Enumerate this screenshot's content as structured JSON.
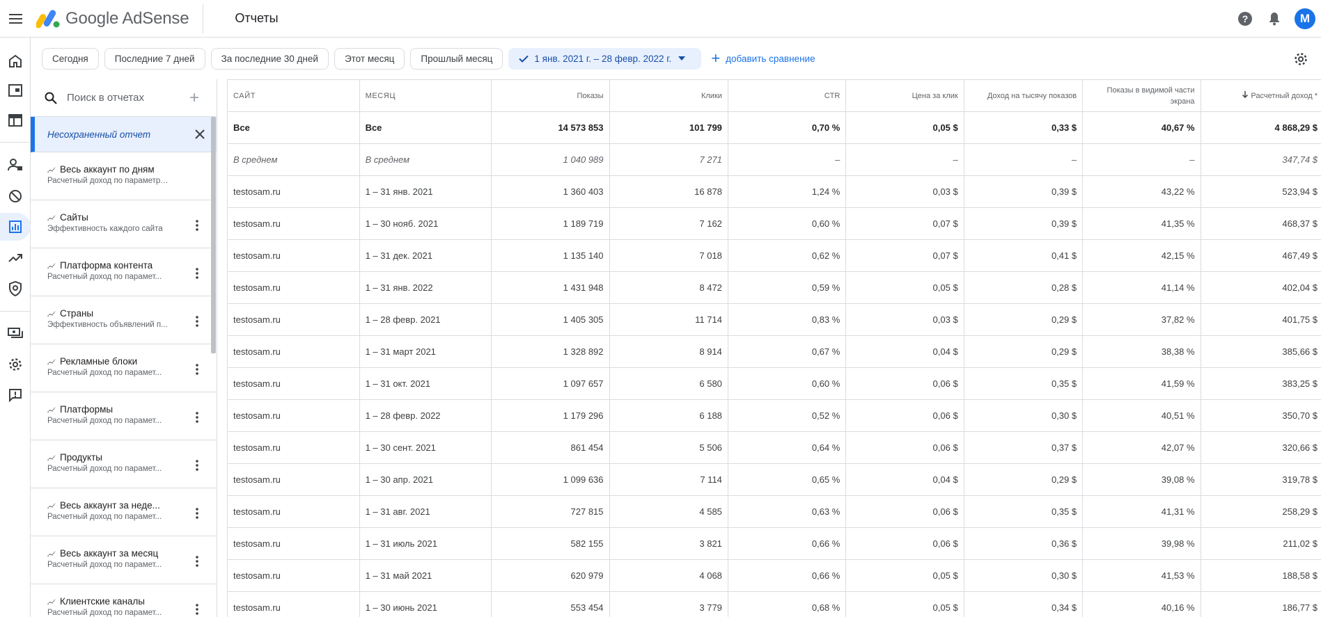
{
  "header": {
    "app_name": "Google AdSense",
    "page_title": "Отчеты",
    "avatar_letter": "M"
  },
  "colors": {
    "accent": "#1a73e8",
    "selected_bg": "#e8f0fe",
    "border": "#dadce0"
  },
  "filters": {
    "today": "Сегодня",
    "last7": "Последние 7 дней",
    "last30": "За последние 30 дней",
    "this_month": "Этот месяц",
    "last_month": "Прошлый месяц",
    "date_range": "1 янв. 2021 г. – 28 февр. 2022 г.",
    "add_compare": "добавить сравнение"
  },
  "reports": {
    "search_placeholder": "Поиск в отчетах",
    "unsaved": "Несохраненный отчет",
    "items": [
      {
        "title": "Весь аккаунт по дням",
        "sub": "Расчетный доход по параметру \"Дата\"",
        "menu": false
      },
      {
        "title": "Сайты",
        "sub": "Эффективность каждого сайта",
        "menu": true
      },
      {
        "title": "Платформа контента",
        "sub": "Расчетный доход по парамет...",
        "menu": true
      },
      {
        "title": "Страны",
        "sub": "Эффективность объявлений п...",
        "menu": true
      },
      {
        "title": "Рекламные блоки",
        "sub": "Расчетный доход по парамет...",
        "menu": true
      },
      {
        "title": "Платформы",
        "sub": "Расчетный доход по парамет...",
        "menu": true
      },
      {
        "title": "Продукты",
        "sub": "Расчетный доход по парамет...",
        "menu": true
      },
      {
        "title": "Весь аккаунт за неде...",
        "sub": "Расчетный доход по парамет...",
        "menu": true
      },
      {
        "title": "Весь аккаунт за месяц",
        "sub": "Расчетный доход по парамет...",
        "menu": true
      },
      {
        "title": "Клиентские каналы",
        "sub": "Расчетный доход по парамет...",
        "menu": true
      }
    ]
  },
  "table": {
    "columns": [
      "Сайт",
      "Месяц",
      "Показы",
      "Клики",
      "CTR",
      "Цена за клик",
      "Доход на тысячу показов",
      "Показы в видимой части экрана",
      "Расчетный доход *"
    ],
    "total": [
      "Все",
      "Все",
      "14 573 853",
      "101 799",
      "0,70 %",
      "0,05 $",
      "0,33 $",
      "40,67 %",
      "4 868,29 $"
    ],
    "average": [
      "В среднем",
      "В среднем",
      "1 040 989",
      "7 271",
      "–",
      "–",
      "–",
      "–",
      "347,74 $"
    ],
    "rows": [
      [
        "testosam.ru",
        "1 – 31 янв. 2021",
        "1 360 403",
        "16 878",
        "1,24 %",
        "0,03 $",
        "0,39 $",
        "43,22 %",
        "523,94 $"
      ],
      [
        "testosam.ru",
        "1 – 30 нояб. 2021",
        "1 189 719",
        "7 162",
        "0,60 %",
        "0,07 $",
        "0,39 $",
        "41,35 %",
        "468,37 $"
      ],
      [
        "testosam.ru",
        "1 – 31 дек. 2021",
        "1 135 140",
        "7 018",
        "0,62 %",
        "0,07 $",
        "0,41 $",
        "42,15 %",
        "467,49 $"
      ],
      [
        "testosam.ru",
        "1 – 31 янв. 2022",
        "1 431 948",
        "8 472",
        "0,59 %",
        "0,05 $",
        "0,28 $",
        "41,14 %",
        "402,04 $"
      ],
      [
        "testosam.ru",
        "1 – 28 февр. 2021",
        "1 405 305",
        "11 714",
        "0,83 %",
        "0,03 $",
        "0,29 $",
        "37,82 %",
        "401,75 $"
      ],
      [
        "testosam.ru",
        "1 – 31 март 2021",
        "1 328 892",
        "8 914",
        "0,67 %",
        "0,04 $",
        "0,29 $",
        "38,38 %",
        "385,66 $"
      ],
      [
        "testosam.ru",
        "1 – 31 окт. 2021",
        "1 097 657",
        "6 580",
        "0,60 %",
        "0,06 $",
        "0,35 $",
        "41,59 %",
        "383,25 $"
      ],
      [
        "testosam.ru",
        "1 – 28 февр. 2022",
        "1 179 296",
        "6 188",
        "0,52 %",
        "0,06 $",
        "0,30 $",
        "40,51 %",
        "350,70 $"
      ],
      [
        "testosam.ru",
        "1 – 30 сент. 2021",
        "861 454",
        "5 506",
        "0,64 %",
        "0,06 $",
        "0,37 $",
        "42,07 %",
        "320,66 $"
      ],
      [
        "testosam.ru",
        "1 – 30 апр. 2021",
        "1 099 636",
        "7 114",
        "0,65 %",
        "0,04 $",
        "0,29 $",
        "39,08 %",
        "319,78 $"
      ],
      [
        "testosam.ru",
        "1 – 31 авг. 2021",
        "727 815",
        "4 585",
        "0,63 %",
        "0,06 $",
        "0,35 $",
        "41,31 %",
        "258,29 $"
      ],
      [
        "testosam.ru",
        "1 – 31 июль 2021",
        "582 155",
        "3 821",
        "0,66 %",
        "0,06 $",
        "0,36 $",
        "39,98 %",
        "211,02 $"
      ],
      [
        "testosam.ru",
        "1 – 31 май 2021",
        "620 979",
        "4 068",
        "0,66 %",
        "0,05 $",
        "0,30 $",
        "41,53 %",
        "188,58 $"
      ],
      [
        "testosam.ru",
        "1 – 30 июнь 2021",
        "553 454",
        "3 779",
        "0,68 %",
        "0,05 $",
        "0,34 $",
        "40,16 %",
        "186,77 $"
      ]
    ]
  },
  "icons": {
    "rail": [
      "home-icon",
      "sites-icon",
      "ads-icon",
      "privacy-icon",
      "blocking-icon",
      "reports-icon",
      "optimization-icon",
      "policy-icon",
      "payments-icon",
      "settings-icon",
      "feedback-icon"
    ]
  }
}
